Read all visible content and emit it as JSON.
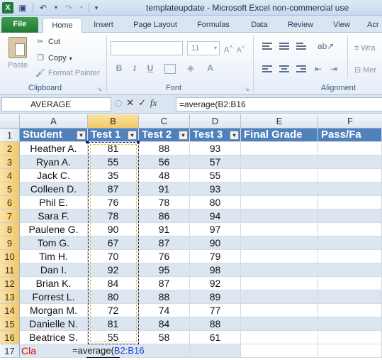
{
  "window": {
    "title": "templateupdate - Microsoft Excel non-commercial use",
    "app_icon": "X"
  },
  "qat": {
    "save_icon": "save-icon",
    "undo_icon": "undo-icon",
    "redo_icon": "redo-icon",
    "customize_icon": "customize-qat-icon"
  },
  "ribbon_tabs": [
    {
      "label": "File"
    },
    {
      "label": "Home"
    },
    {
      "label": "Insert"
    },
    {
      "label": "Page Layout"
    },
    {
      "label": "Formulas"
    },
    {
      "label": "Data"
    },
    {
      "label": "Review"
    },
    {
      "label": "View"
    },
    {
      "label": "Acr"
    }
  ],
  "clipboard": {
    "paste_label": "Paste",
    "cut_label": "Cut",
    "copy_label": "Copy",
    "format_painter_label": "Format Painter",
    "group_label": "Clipboard"
  },
  "font": {
    "size": "11",
    "bold": "B",
    "italic": "I",
    "underline": "U",
    "group_label": "Font"
  },
  "alignment": {
    "group_label": "Alignment",
    "wrap_label": "Wra",
    "merge_label": "Mer"
  },
  "formula_bar": {
    "name_box": "AVERAGE",
    "cancel": "✕",
    "enter": "✓",
    "fx": "fx",
    "formula": "=average(B2:B16"
  },
  "columns": [
    "A",
    "B",
    "C",
    "D",
    "E",
    "F"
  ],
  "rows": [
    "1",
    "2",
    "3",
    "4",
    "5",
    "6",
    "7",
    "8",
    "9",
    "10",
    "11",
    "12",
    "13",
    "14",
    "15",
    "16",
    "17"
  ],
  "header_row": [
    "Student",
    "Test 1",
    "Test 2",
    "Test 3",
    "Final Grade",
    "Pass/Fa"
  ],
  "students": [
    {
      "name": "Heather A.",
      "t1": "81",
      "t2": "88",
      "t3": "93"
    },
    {
      "name": "Ryan A.",
      "t1": "55",
      "t2": "56",
      "t3": "57"
    },
    {
      "name": "Jack C.",
      "t1": "35",
      "t2": "48",
      "t3": "55"
    },
    {
      "name": "Colleen D.",
      "t1": "87",
      "t2": "91",
      "t3": "93"
    },
    {
      "name": "Phil E.",
      "t1": "76",
      "t2": "78",
      "t3": "80"
    },
    {
      "name": "Sara F.",
      "t1": "78",
      "t2": "86",
      "t3": "94"
    },
    {
      "name": "Paulene G.",
      "t1": "90",
      "t2": "91",
      "t3": "97"
    },
    {
      "name": "Tom G.",
      "t1": "67",
      "t2": "87",
      "t3": "90"
    },
    {
      "name": "Tim H.",
      "t1": "70",
      "t2": "76",
      "t3": "79"
    },
    {
      "name": "Dan I.",
      "t1": "92",
      "t2": "95",
      "t3": "98"
    },
    {
      "name": "Brian K.",
      "t1": "84",
      "t2": "87",
      "t3": "92"
    },
    {
      "name": "Forrest L.",
      "t1": "80",
      "t2": "88",
      "t3": "89"
    },
    {
      "name": "Morgan M.",
      "t1": "72",
      "t2": "74",
      "t3": "77"
    },
    {
      "name": "Danielle N.",
      "t1": "81",
      "t2": "84",
      "t3": "88"
    },
    {
      "name": "Beatrice S.",
      "t1": "55",
      "t2": "58",
      "t3": "61"
    }
  ],
  "row17": {
    "a_text": "Cla",
    "edit_prefix": "=average(",
    "edit_ref": "B2:B16"
  },
  "colors": {
    "header_fill": "#4f81bd",
    "band_fill": "#dce6f1",
    "ref_color": "#1a3fcc",
    "a17_color": "#e00000"
  }
}
